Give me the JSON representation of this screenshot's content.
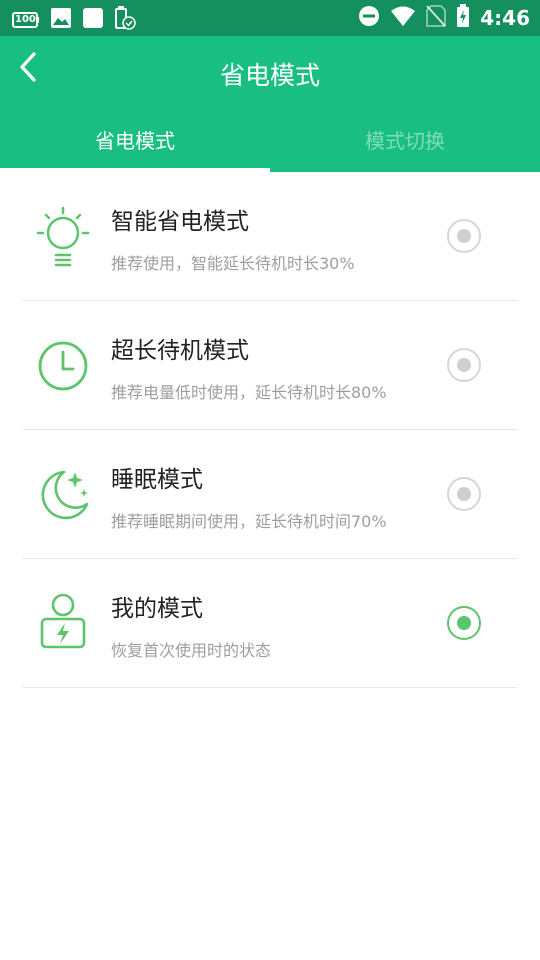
{
  "status_bar": {
    "time": "4:46",
    "battery_text": "100",
    "icons": [
      "battery-100-icon",
      "image-icon",
      "square-icon",
      "battery-check-icon",
      "dnd-icon",
      "wifi-icon",
      "no-sim-icon",
      "battery-charging-icon"
    ]
  },
  "header": {
    "title": "省电模式",
    "back_icon": "chevron-left-icon"
  },
  "tabs": [
    {
      "label": "省电模式",
      "active": true
    },
    {
      "label": "模式切换",
      "active": false
    }
  ],
  "modes": [
    {
      "title": "智能省电模式",
      "subtitle": "推荐使用，智能延长待机时长30%",
      "icon": "bulb-icon",
      "selected": false
    },
    {
      "title": "超长待机模式",
      "subtitle": "推荐电量低时使用，延长待机时长80%",
      "icon": "clock-icon",
      "selected": false
    },
    {
      "title": "睡眠模式",
      "subtitle": "推荐睡眠期间使用，延长待机时间70%",
      "icon": "moon-icon",
      "selected": false
    },
    {
      "title": "我的模式",
      "subtitle": "恢复首次使用时的状态",
      "icon": "user-battery-icon",
      "selected": true
    }
  ],
  "colors": {
    "status_bar": "#148f5e",
    "app_bar": "#19bf82",
    "accent": "#5cc56b",
    "tab_inactive": "#7fdcb8"
  }
}
